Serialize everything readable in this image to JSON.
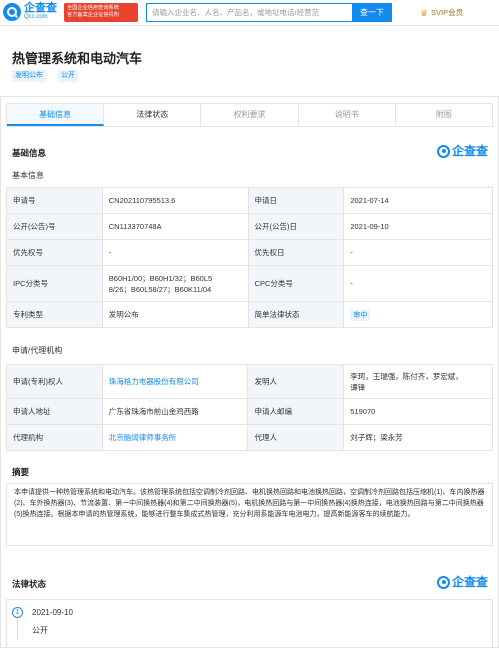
{
  "header": {
    "logo_name": "企查查",
    "logo_domain": "Qcc.com",
    "badge_line1": "全国企业信用查询系统",
    "badge_line2": "官方备案企业征信机构",
    "search_placeholder": "请输入企业名、人名、产品名，或地址电话/经营范",
    "search_button": "查一下",
    "svip_label": "SVIP会员"
  },
  "title": "热管理系统和电动汽车",
  "tags": [
    "发明公布",
    "公开"
  ],
  "tabs": [
    {
      "label": "基础信息"
    },
    {
      "label": "法律状态"
    },
    {
      "label": "权利要求"
    },
    {
      "label": "说明书"
    },
    {
      "label": "附图"
    }
  ],
  "section_basic": "基础信息",
  "qcc_logo_text": "企查查",
  "sub_basic": "基本信息",
  "basic_info": {
    "app_no_label": "申请号",
    "app_no": "CN202110795513.6",
    "app_date_label": "申请日",
    "app_date": "2021-07-14",
    "pub_no_label": "公开(公告)号",
    "pub_no": "CN113370748A",
    "pub_date_label": "公开(公告)日",
    "pub_date": "2021-09-10",
    "priority_no_label": "优先权号",
    "priority_no": "-",
    "priority_date_label": "优先权日",
    "priority_date": "-",
    "ipc_label": "IPC分类号",
    "ipc_line1": "B60H1/00；B60H1/32；B60L5",
    "ipc_line2": "8/26；B60L58/27；B60K11/04",
    "cpc_label": "CPC分类号",
    "cpc": "-",
    "type_label": "专利类型",
    "type": "发明公布",
    "status_label": "简单法律状态",
    "status": "审中"
  },
  "sub_applicant": "申请/代理机构",
  "applicant": {
    "holder_label": "申请(专利)权人",
    "holder": "珠海格力电器股份有限公司",
    "inventor_label": "发明人",
    "inventor_line1": "李珂，王瑞强，陈付齐，罗宏斌，",
    "inventor_line2": "谭锋",
    "address_label": "申请人地址",
    "address": "广东省珠海市前山金鸡西路",
    "zip_label": "申请人邮编",
    "zip": "519070",
    "agency_label": "代理机构",
    "agency": "北京脑阔律师事务所",
    "agent_label": "代理人",
    "agent": "刘子辉；梁永芳"
  },
  "section_abstract": "摘要",
  "abstract": "本申请提供一种热管理系统和电动汽车。该热管理系统包括空调制冷剂回路、电机换热回路和电池换热回路，空调制冷剂回路包括压缩机(1)、车内换热器(2)、车外换热器(3)、节流装置、第一中间换热器(4)和第二中间换热器(5)，电机换热回路与第一中间换热器(4)换热连接，电池换热回路与第二中间换热器(5)换热连接。根据本申请的热管理系统，能够进行整车集成式热管理，充分利用系能源车电池电力，提高新能源客车的续航能力。",
  "section_legal": "法律状态",
  "legal": {
    "index": "1",
    "date": "2021-09-10",
    "status": "公开"
  }
}
